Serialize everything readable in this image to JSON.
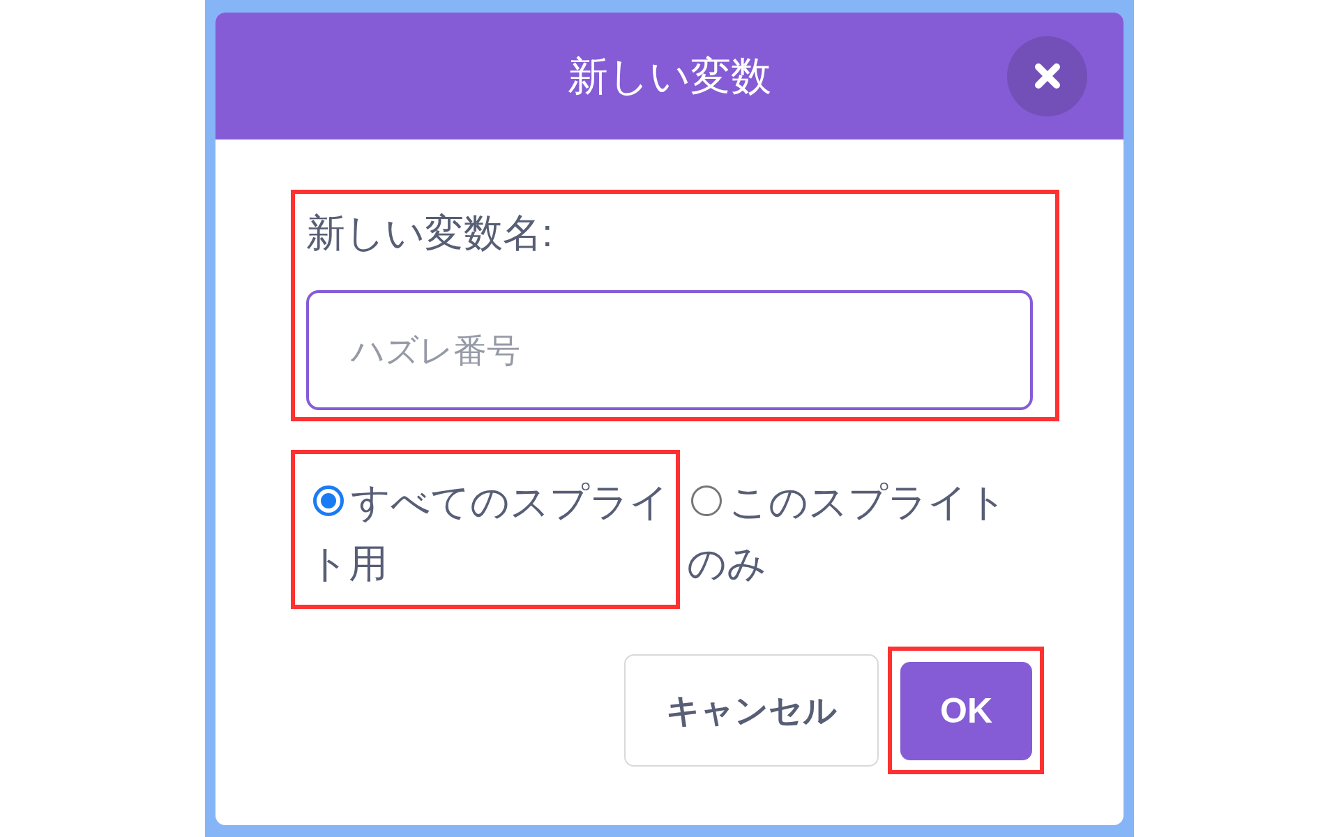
{
  "dialog": {
    "title": "新しい変数"
  },
  "name_field": {
    "label": "新しい変数名:",
    "placeholder": "ハズレ番号",
    "highlighted": true
  },
  "scope_options": [
    {
      "label": "すべてのスプライト用",
      "selected": true,
      "highlighted": true
    },
    {
      "label": "このスプライトのみ",
      "selected": false,
      "highlighted": false
    }
  ],
  "buttons": [
    {
      "label": "キャンセル",
      "kind": "secondary",
      "highlighted": false
    },
    {
      "label": "OK",
      "kind": "primary",
      "highlighted": true
    }
  ]
}
